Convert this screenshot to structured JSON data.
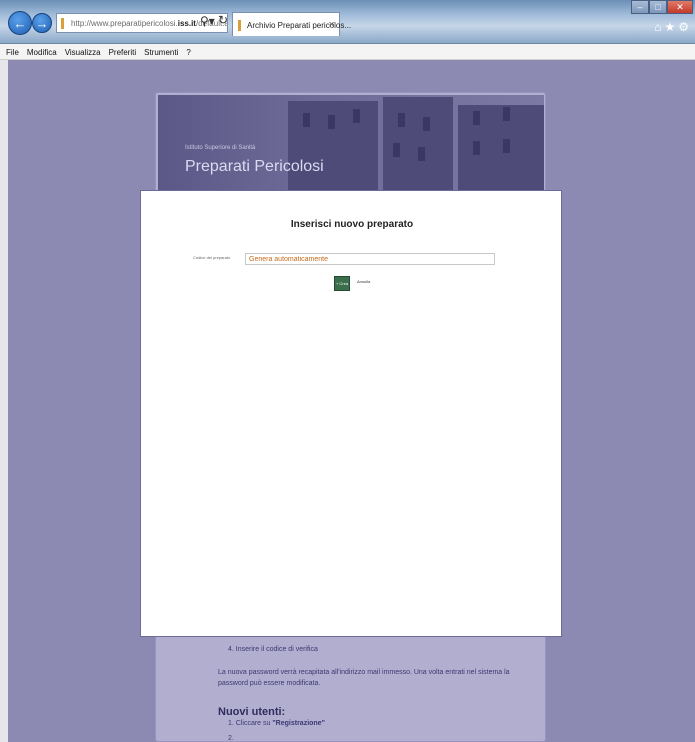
{
  "browser": {
    "address_prefix": "http://www.preparatipericolosi.",
    "address_domain": "iss.it",
    "address_suffix": "/default.aspx",
    "tab_title": "Archivio Preparati pericolos...",
    "menu": [
      "File",
      "Modifica",
      "Visualizza",
      "Preferiti",
      "Strumenti",
      "?"
    ]
  },
  "banner": {
    "subtitle": "Istituto Superiore di Sanità",
    "title": "Preparati Pericolosi"
  },
  "modal": {
    "title": "Inserisci nuovo preparato",
    "field_label": "Codice del preparato",
    "field_value": "Genera automaticamente",
    "create_button": "+ Crea",
    "cancel_link": "Annulla"
  },
  "page": {
    "step4": "4.   Inserire il codice di verifica",
    "password_note": "La nuova password verrà recapitata all'indirizzo mail immesso. Una volta entrati nel sistema la password può essere modificata.",
    "new_users_heading": "Nuovi utenti:",
    "step1_prefix": "1.   Cliccare su ",
    "step1_link": "\"Registrazione\""
  }
}
